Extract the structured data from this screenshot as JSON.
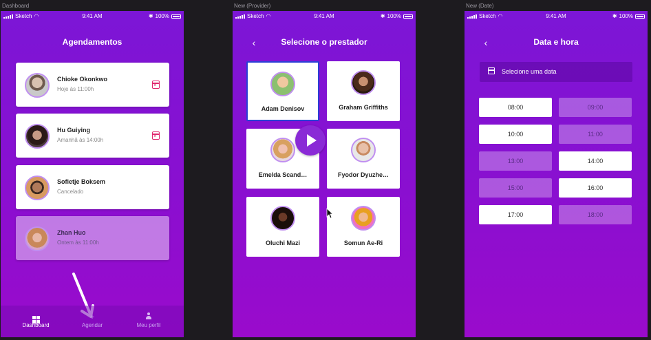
{
  "artboards": [
    {
      "label": "Dashboard"
    },
    {
      "label": "New (Provider)"
    },
    {
      "label": "New (Date)"
    }
  ],
  "status": {
    "carrier": "Sketch",
    "time": "9:41 AM",
    "battery": "100%"
  },
  "dashboard": {
    "title": "Agendamentos",
    "appointments": [
      {
        "name": "Chioke Okonkwo",
        "detail": "Hoje às 11:00h"
      },
      {
        "name": "Hu Guiying",
        "detail": "Amanhã às 14:00h"
      },
      {
        "name": "Sofietje Boksem",
        "detail": "Cancelado"
      },
      {
        "name": "Zhan Huo",
        "detail": "Ontem às 11:00h"
      }
    ],
    "tabs": [
      {
        "label": "Dashboard",
        "icon": "dashboard-grid-icon"
      },
      {
        "label": "Agendar",
        "icon": "plus-icon",
        "glyph": "+"
      },
      {
        "label": "Meu perfil",
        "icon": "person-icon"
      }
    ]
  },
  "provider": {
    "title": "Selecione o prestador",
    "back": "‹",
    "providers": [
      {
        "name": "Adam Denisov"
      },
      {
        "name": "Graham Griffiths"
      },
      {
        "name": "Emelda Scand…"
      },
      {
        "name": "Fyodor Dyuzhe…"
      },
      {
        "name": "Oluchi Mazi"
      },
      {
        "name": "Somun Ae-Ri"
      }
    ]
  },
  "date": {
    "title": "Data e hora",
    "back": "‹",
    "select_label": "Selecione uma data",
    "slots": [
      {
        "time": "08:00",
        "available": true
      },
      {
        "time": "09:00",
        "available": false
      },
      {
        "time": "10:00",
        "available": true
      },
      {
        "time": "11:00",
        "available": false
      },
      {
        "time": "13:00",
        "available": false
      },
      {
        "time": "14:00",
        "available": true
      },
      {
        "time": "15:00",
        "available": false
      },
      {
        "time": "16:00",
        "available": true
      },
      {
        "time": "17:00",
        "available": true
      },
      {
        "time": "18:00",
        "available": false
      }
    ]
  },
  "colors": {
    "accent": "#8a0fd0",
    "cancel_icon": "#e0286f",
    "selected_border": "#2b3fd6"
  }
}
